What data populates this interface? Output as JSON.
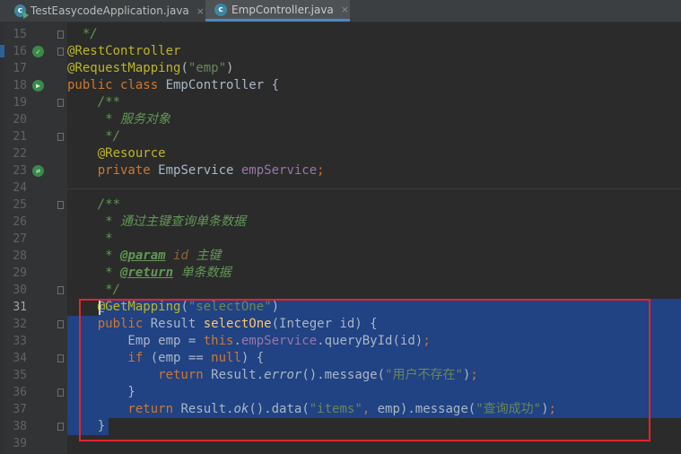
{
  "tabs": [
    {
      "label": "TestEasycodeApplication.java",
      "icon": "class-run-icon",
      "active": false
    },
    {
      "label": "EmpController.java",
      "icon": "class-icon",
      "active": true
    }
  ],
  "tab_icon_letter": "c",
  "tab_close_glyph": "×",
  "selection_start_line": 31,
  "selection_end_line": 38,
  "current_line": 31,
  "lines": [
    {
      "n": 15,
      "gutter": "",
      "fold": true,
      "tokens": [
        [
          "doc",
          "  */"
        ]
      ]
    },
    {
      "n": 16,
      "gutter": "bean-icon",
      "fold": true,
      "tokens": [
        [
          "ann",
          "@RestController"
        ]
      ]
    },
    {
      "n": 17,
      "gutter": "",
      "fold": false,
      "tokens": [
        [
          "ann",
          "@RequestMapping"
        ],
        [
          "plain",
          "("
        ],
        [
          "str",
          "\"emp\""
        ],
        [
          "plain",
          ")"
        ]
      ]
    },
    {
      "n": 18,
      "gutter": "run-class-icon",
      "fold": false,
      "tokens": [
        [
          "kw",
          "public class "
        ],
        [
          "plain",
          "EmpController {"
        ]
      ]
    },
    {
      "n": 19,
      "gutter": "",
      "fold": true,
      "tokens": [
        [
          "doc",
          "    /**"
        ]
      ]
    },
    {
      "n": 20,
      "gutter": "",
      "fold": false,
      "tokens": [
        [
          "doc",
          "     * 服务对象"
        ]
      ]
    },
    {
      "n": 21,
      "gutter": "",
      "fold": true,
      "tokens": [
        [
          "doc",
          "     */"
        ]
      ]
    },
    {
      "n": 22,
      "gutter": "",
      "fold": false,
      "tokens": [
        [
          "ann",
          "    @Resource"
        ]
      ]
    },
    {
      "n": 23,
      "gutter": "autowire-icon",
      "fold": false,
      "tokens": [
        [
          "kw",
          "    private "
        ],
        [
          "plain",
          "EmpService "
        ],
        [
          "field",
          "empService"
        ],
        [
          "kw",
          ";"
        ]
      ]
    },
    {
      "n": 24,
      "gutter": "",
      "fold": false,
      "tokens": []
    },
    {
      "n": 25,
      "gutter": "",
      "fold": true,
      "tokens": [
        [
          "doc",
          "    /**"
        ]
      ]
    },
    {
      "n": 26,
      "gutter": "",
      "fold": false,
      "tokens": [
        [
          "doc",
          "     * 通过主键查询单条数据"
        ]
      ]
    },
    {
      "n": 27,
      "gutter": "",
      "fold": false,
      "tokens": [
        [
          "doc",
          "     *"
        ]
      ]
    },
    {
      "n": 28,
      "gutter": "",
      "fold": false,
      "tokens": [
        [
          "doc",
          "     * "
        ],
        [
          "tag",
          "@param"
        ],
        [
          "doc",
          " "
        ],
        [
          "docval",
          "id"
        ],
        [
          "doc",
          " 主键"
        ]
      ]
    },
    {
      "n": 29,
      "gutter": "",
      "fold": false,
      "tokens": [
        [
          "doc",
          "     * "
        ],
        [
          "tag",
          "@return"
        ],
        [
          "doc",
          " 单条数据"
        ]
      ]
    },
    {
      "n": 30,
      "gutter": "",
      "fold": true,
      "tokens": [
        [
          "doc",
          "     */"
        ]
      ]
    },
    {
      "n": 31,
      "gutter": "",
      "fold": false,
      "tokens": [
        [
          "ann",
          "    @GetMapping"
        ],
        [
          "plain",
          "("
        ],
        [
          "str",
          "\"selectOne\""
        ],
        [
          "plain",
          ")"
        ]
      ]
    },
    {
      "n": 32,
      "gutter": "",
      "fold": true,
      "tokens": [
        [
          "kw",
          "    public "
        ],
        [
          "plain",
          "Result "
        ],
        [
          "fn",
          "selectOne"
        ],
        [
          "plain",
          "(Integer id) {"
        ]
      ]
    },
    {
      "n": 33,
      "gutter": "",
      "fold": false,
      "tokens": [
        [
          "plain",
          "        Emp emp = "
        ],
        [
          "kw",
          "this"
        ],
        [
          "plain",
          "."
        ],
        [
          "field",
          "empService"
        ],
        [
          "plain",
          ".queryById(id)"
        ],
        [
          "kw",
          ";"
        ]
      ]
    },
    {
      "n": 34,
      "gutter": "",
      "fold": true,
      "tokens": [
        [
          "kw",
          "        if "
        ],
        [
          "plain",
          "(emp == "
        ],
        [
          "kw",
          "null"
        ],
        [
          "plain",
          ") {"
        ]
      ]
    },
    {
      "n": 35,
      "gutter": "",
      "fold": false,
      "tokens": [
        [
          "kw",
          "            return "
        ],
        [
          "plain",
          "Result."
        ],
        [
          "static",
          "error"
        ],
        [
          "plain",
          "().message("
        ],
        [
          "str",
          "\"用户不存在\""
        ],
        [
          "plain",
          ")"
        ],
        [
          "kw",
          ";"
        ]
      ]
    },
    {
      "n": 36,
      "gutter": "",
      "fold": true,
      "tokens": [
        [
          "plain",
          "        }"
        ]
      ]
    },
    {
      "n": 37,
      "gutter": "",
      "fold": false,
      "tokens": [
        [
          "kw",
          "        return "
        ],
        [
          "plain",
          "Result."
        ],
        [
          "static",
          "ok"
        ],
        [
          "plain",
          "().data("
        ],
        [
          "str",
          "\"items\""
        ],
        [
          "kw",
          ", "
        ],
        [
          "plain",
          "emp).message("
        ],
        [
          "str",
          "\"查询成功\""
        ],
        [
          "plain",
          ")"
        ],
        [
          "kw",
          ";"
        ]
      ]
    },
    {
      "n": 38,
      "gutter": "",
      "fold": true,
      "tokens": [
        [
          "plain",
          "    }"
        ]
      ]
    },
    {
      "n": 39,
      "gutter": "",
      "fold": false,
      "tokens": []
    }
  ]
}
